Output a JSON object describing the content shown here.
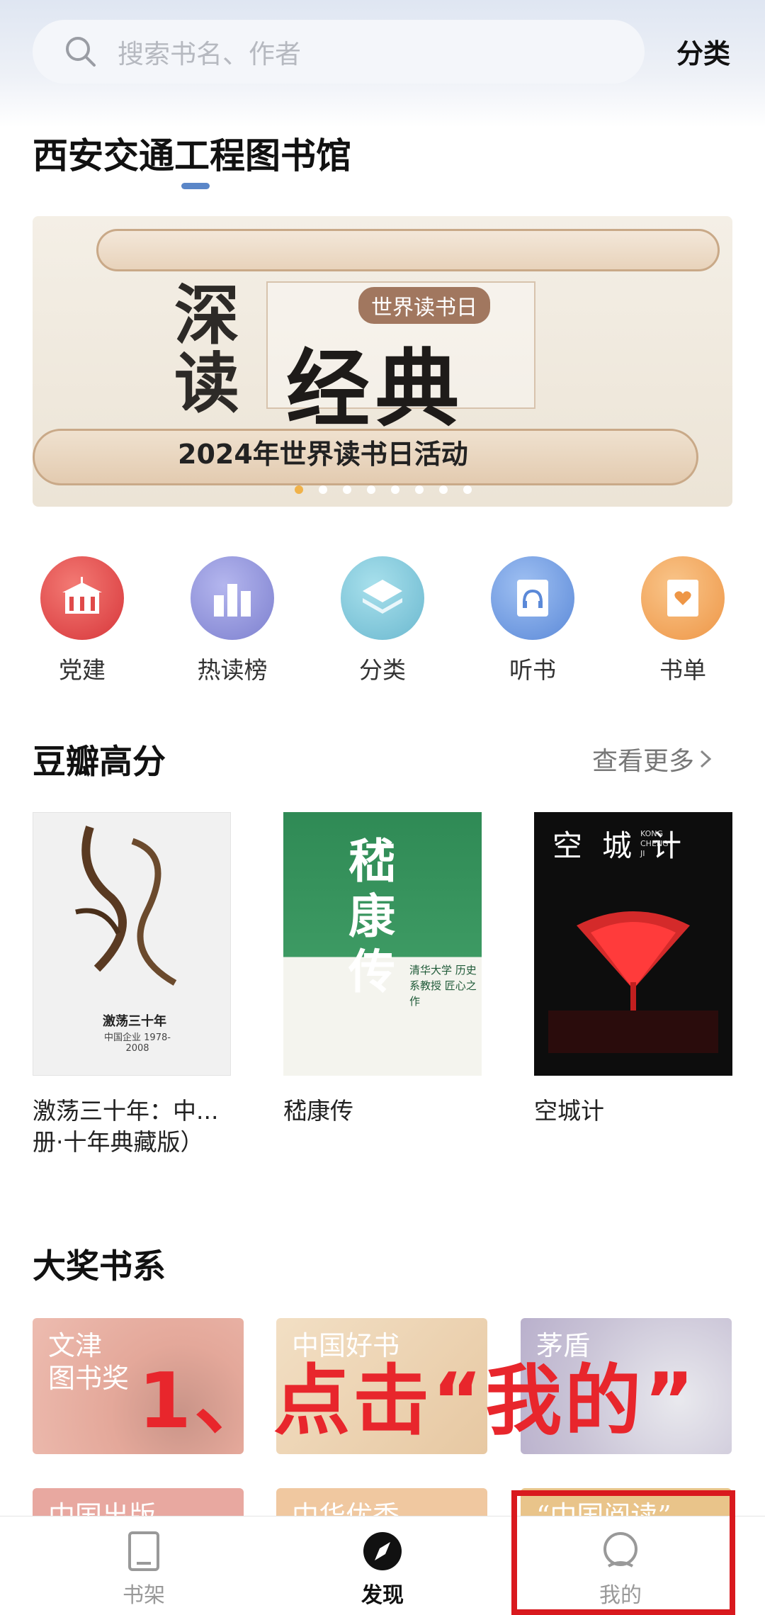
{
  "search": {
    "placeholder": "搜索书名、作者",
    "category_label": "分类"
  },
  "library": {
    "title": "西安交通工程图书馆"
  },
  "banner": {
    "vertical_text": "深读",
    "big_text": "经典",
    "tag": "世界读书日",
    "subtitle": "2024年世界读书日活动",
    "dots": 8,
    "active_dot": 0
  },
  "quick_icons": [
    {
      "label": "党建",
      "icon": "party-building-icon",
      "color": "#e04a4a"
    },
    {
      "label": "热读榜",
      "icon": "ranking-icon",
      "color": "#8c8fd6"
    },
    {
      "label": "分类",
      "icon": "category-layers-icon",
      "color": "#7fc6d8"
    },
    {
      "label": "听书",
      "icon": "audiobook-icon",
      "color": "#6e9ae0"
    },
    {
      "label": "书单",
      "icon": "booklist-heart-icon",
      "color": "#f2a255"
    }
  ],
  "douban": {
    "title": "豆瓣高分",
    "more": "查看更多",
    "books": [
      {
        "title": "激荡三十年：中...册·十年典藏版）",
        "title_line1": "激荡三十年：中...",
        "title_line2": "册·十年典藏版）",
        "cover_text": "激荡三十年",
        "cover_sub": "中国企业 1978-2008"
      },
      {
        "title": "嵇康传",
        "cover_text": "嵇康传",
        "cover_sub": "清华大学 历史系教授 匠心之作"
      },
      {
        "title": "空城计",
        "cover_text": "空城计",
        "cover_sub": "KONG CHENG JI"
      }
    ]
  },
  "awards": {
    "title": "大奖书系",
    "items": [
      {
        "label": "文津图书奖",
        "line1": "文津",
        "line2": "图书奖"
      },
      {
        "label": "中国好书",
        "line1": "中国好书",
        "line2": ""
      },
      {
        "label": "茅盾",
        "line1": "茅盾",
        "line2": ""
      },
      {
        "label": "中国出版",
        "line1": "中国出版",
        "line2": ""
      },
      {
        "label": "中华优秀",
        "line1": "中华优秀",
        "line2": ""
      },
      {
        "label": "“中国阅读”",
        "line1": "“中国阅读”",
        "line2": ""
      }
    ]
  },
  "overlay_instruction": "1、点击“我的”",
  "tabs": [
    {
      "label": "书架",
      "icon": "bookshelf-icon",
      "active": false
    },
    {
      "label": "发现",
      "icon": "discover-compass-icon",
      "active": true
    },
    {
      "label": "我的",
      "icon": "profile-icon",
      "active": false
    }
  ],
  "colors": {
    "accent": "#5a86c8",
    "highlight": "#e8262c",
    "dot_active": "#f0b24a"
  }
}
